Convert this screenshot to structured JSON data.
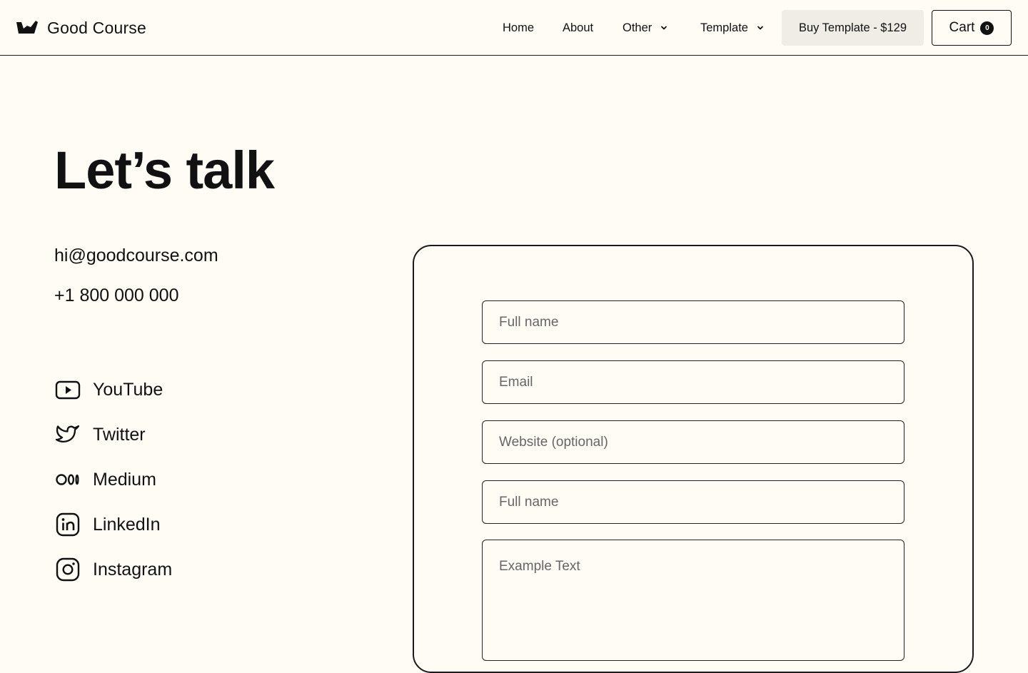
{
  "header": {
    "brand": {
      "name": "Good Course",
      "logo_icon": "good-course-logo-icon"
    },
    "nav": [
      {
        "label": "Home",
        "has_dropdown": false
      },
      {
        "label": "About",
        "has_dropdown": false
      },
      {
        "label": "Other",
        "has_dropdown": true
      },
      {
        "label": "Template",
        "has_dropdown": true
      }
    ],
    "buy_button": "Buy Template - $129",
    "cart": {
      "label": "Cart",
      "count": "0"
    }
  },
  "main": {
    "title": "Let’s talk",
    "email": "hi@goodcourse.com",
    "phone": "+1 800 000 000",
    "socials": [
      {
        "label": "YouTube",
        "icon": "youtube-icon"
      },
      {
        "label": "Twitter",
        "icon": "twitter-icon"
      },
      {
        "label": "Medium",
        "icon": "medium-icon"
      },
      {
        "label": "LinkedIn",
        "icon": "linkedin-icon"
      },
      {
        "label": "Instagram",
        "icon": "instagram-icon"
      }
    ]
  },
  "form": {
    "fields": [
      {
        "placeholder": "Full name",
        "value": ""
      },
      {
        "placeholder": "Email",
        "value": ""
      },
      {
        "placeholder": "Website (optional)",
        "value": ""
      },
      {
        "placeholder": "Full name",
        "value": ""
      }
    ],
    "message": {
      "placeholder": "Example Text",
      "value": ""
    }
  },
  "colors": {
    "background": "#fffcf5",
    "text": "#111111",
    "buy_button_bg": "#efede6",
    "border": "#1a1a1a"
  }
}
